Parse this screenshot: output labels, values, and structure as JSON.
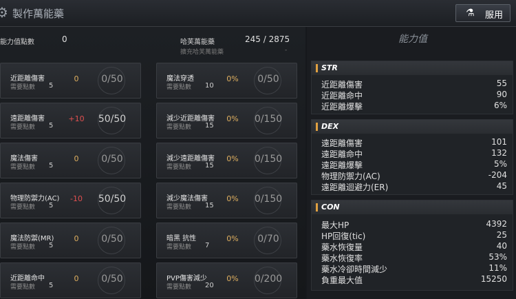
{
  "header": {
    "title": "製作萬能藥",
    "use_button": "服用"
  },
  "top": {
    "points_label": "能力值點數",
    "points_value": "0",
    "elixir_label": "哈芙萬能藥",
    "elixir_value": "245 / 2875",
    "elixir_sub_label": "擴充哈芙萬能藥",
    "elixir_sub_value": "-"
  },
  "cards": [
    {
      "name": "近距離傷害",
      "cost_label": "需要點數",
      "cost": "5",
      "bonus": "0",
      "progress": "0/50"
    },
    {
      "name": "魔法穿透",
      "cost_label": "需要點數",
      "cost": "10",
      "bonus": "0%",
      "progress": "0/50"
    },
    {
      "name": "遠距離傷害",
      "cost_label": "需要點數",
      "cost": "5",
      "bonus": "+10",
      "progress": "50/50"
    },
    {
      "name": "減少近距離傷害",
      "cost_label": "需要點數",
      "cost": "15",
      "bonus": "0%",
      "progress": "0/150"
    },
    {
      "name": "魔法傷害",
      "cost_label": "需要點數",
      "cost": "5",
      "bonus": "0",
      "progress": "0/50"
    },
    {
      "name": "減少遠距離傷害",
      "cost_label": "需要點數",
      "cost": "15",
      "bonus": "0%",
      "progress": "0/150"
    },
    {
      "name": "物理防禦力(AC)",
      "cost_label": "需要點數",
      "cost": "5",
      "bonus": "-10",
      "progress": "50/50"
    },
    {
      "name": "減少魔法傷害",
      "cost_label": "需要點數",
      "cost": "15",
      "bonus": "0%",
      "progress": "0/150"
    },
    {
      "name": "魔法防禦(MR)",
      "cost_label": "需要點數",
      "cost": "5",
      "bonus": "0",
      "progress": "0/50"
    },
    {
      "name": "暗黑 抗性",
      "cost_label": "需要點數",
      "cost": "7",
      "bonus": "0%",
      "progress": "0/70"
    },
    {
      "name": "近距離命中",
      "cost_label": "需要點數",
      "cost": "5",
      "bonus": "0",
      "progress": "0/50"
    },
    {
      "name": "PVP傷害減少",
      "cost_label": "需要點數",
      "cost": "20",
      "bonus": "0%",
      "progress": "0/200"
    }
  ],
  "stats_title": "能力值",
  "sections": [
    {
      "title": "STR",
      "rows": [
        {
          "k": "近距離傷害",
          "v": "55"
        },
        {
          "k": "近距離命中",
          "v": "90"
        },
        {
          "k": "近距離爆擊",
          "v": "6%"
        }
      ]
    },
    {
      "title": "DEX",
      "rows": [
        {
          "k": "遠距離傷害",
          "v": "101"
        },
        {
          "k": "遠距離命中",
          "v": "132"
        },
        {
          "k": "遠距離爆擊",
          "v": "5%"
        },
        {
          "k": "物理防禦力(AC)",
          "v": "-204"
        },
        {
          "k": "遠距離迴避力(ER)",
          "v": "45"
        }
      ]
    },
    {
      "title": "CON",
      "rows": [
        {
          "k": "最大HP",
          "v": "4392"
        },
        {
          "k": "HP回復(tic)",
          "v": "25"
        },
        {
          "k": "藥水恢復量",
          "v": "40"
        },
        {
          "k": "藥水恢復率",
          "v": "53%"
        },
        {
          "k": "藥水冷卻時間減少",
          "v": "11%"
        },
        {
          "k": "負重最大值",
          "v": "15250"
        }
      ]
    }
  ],
  "colors": {
    "accent": "#e0a040",
    "positive": "#e05050",
    "gold": "#e0b060"
  },
  "icons": {
    "title": "gear-icon",
    "use": "potion-icon"
  }
}
